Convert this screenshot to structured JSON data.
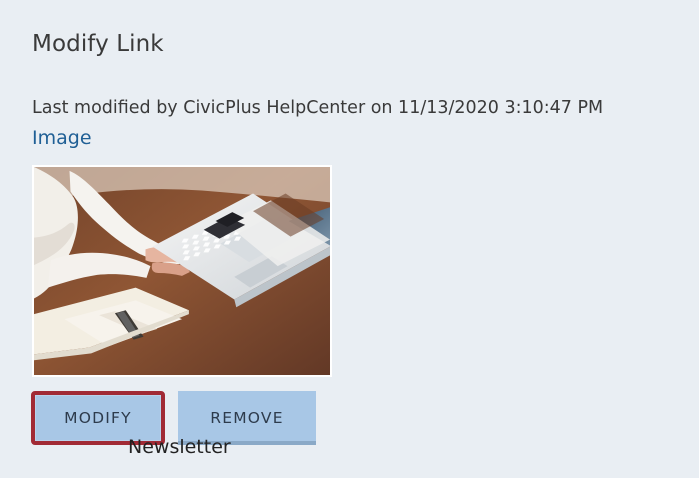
{
  "page": {
    "title": "Modify Link",
    "last_modified_text": "Last modified by CivicPlus HelpCenter on 11/13/2020 3:10:47 PM",
    "image_link_text": "Image",
    "buttons": {
      "modify_label": "MODIFY",
      "remove_label": "REMOVE"
    },
    "underlying_text": "Newsletter"
  },
  "colors": {
    "background": "#e9eef3",
    "button_fill": "#a8c7e6",
    "modify_outline": "#a12a35",
    "link_blue": "#1f5f95"
  },
  "icons": {
    "thumbnail": "image-thumbnail"
  }
}
